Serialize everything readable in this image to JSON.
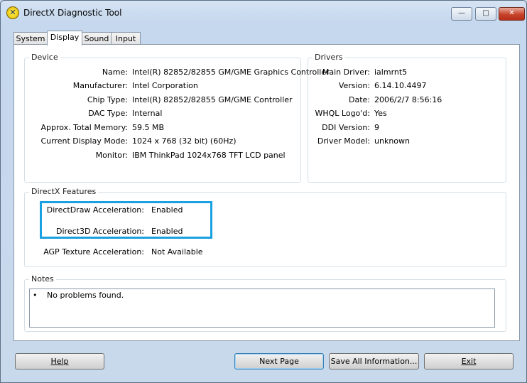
{
  "window": {
    "title": "DirectX Diagnostic Tool",
    "controls": {
      "minimize": "—",
      "maximize": "□",
      "close": "✕"
    }
  },
  "tabs": [
    {
      "label": "System",
      "active": false
    },
    {
      "label": "Display",
      "active": true
    },
    {
      "label": "Sound",
      "active": false
    },
    {
      "label": "Input",
      "active": false
    }
  ],
  "device": {
    "label": "Device",
    "rows": [
      {
        "label": "Name:",
        "value": "Intel(R) 82852/82855 GM/GME Graphics Controller"
      },
      {
        "label": "Manufacturer:",
        "value": "Intel Corporation"
      },
      {
        "label": "Chip Type:",
        "value": "Intel(R) 82852/82855 GM/GME Controller"
      },
      {
        "label": "DAC Type:",
        "value": "Internal"
      },
      {
        "label": "Approx. Total Memory:",
        "value": "59.5 MB"
      },
      {
        "label": "Current Display Mode:",
        "value": "1024 x 768 (32 bit) (60Hz)"
      },
      {
        "label": "Monitor:",
        "value": "IBM ThinkPad 1024x768 TFT LCD panel"
      }
    ]
  },
  "drivers": {
    "label": "Drivers",
    "rows": [
      {
        "label": "Main Driver:",
        "value": "ialmrnt5"
      },
      {
        "label": "Version:",
        "value": "6.14.10.4497"
      },
      {
        "label": "Date:",
        "value": "2006/2/7 8:56:16"
      },
      {
        "label": "WHQL Logo'd:",
        "value": "Yes"
      },
      {
        "label": "DDI Version:",
        "value": "9"
      },
      {
        "label": "Driver Model:",
        "value": "unknown"
      }
    ]
  },
  "features": {
    "label": "DirectX Features",
    "rows": [
      {
        "label": "DirectDraw Acceleration:",
        "value": "Enabled"
      },
      {
        "label": "Direct3D Acceleration:",
        "value": "Enabled"
      },
      {
        "label": "AGP Texture Acceleration:",
        "value": "Not Available"
      }
    ],
    "highlight_color": "#1ba1e2"
  },
  "notes": {
    "label": "Notes",
    "bullet": "•",
    "items": [
      "No problems found."
    ]
  },
  "buttons": {
    "help": "Help",
    "next": "Next Page",
    "save": "Save All Information...",
    "exit": "Exit"
  }
}
